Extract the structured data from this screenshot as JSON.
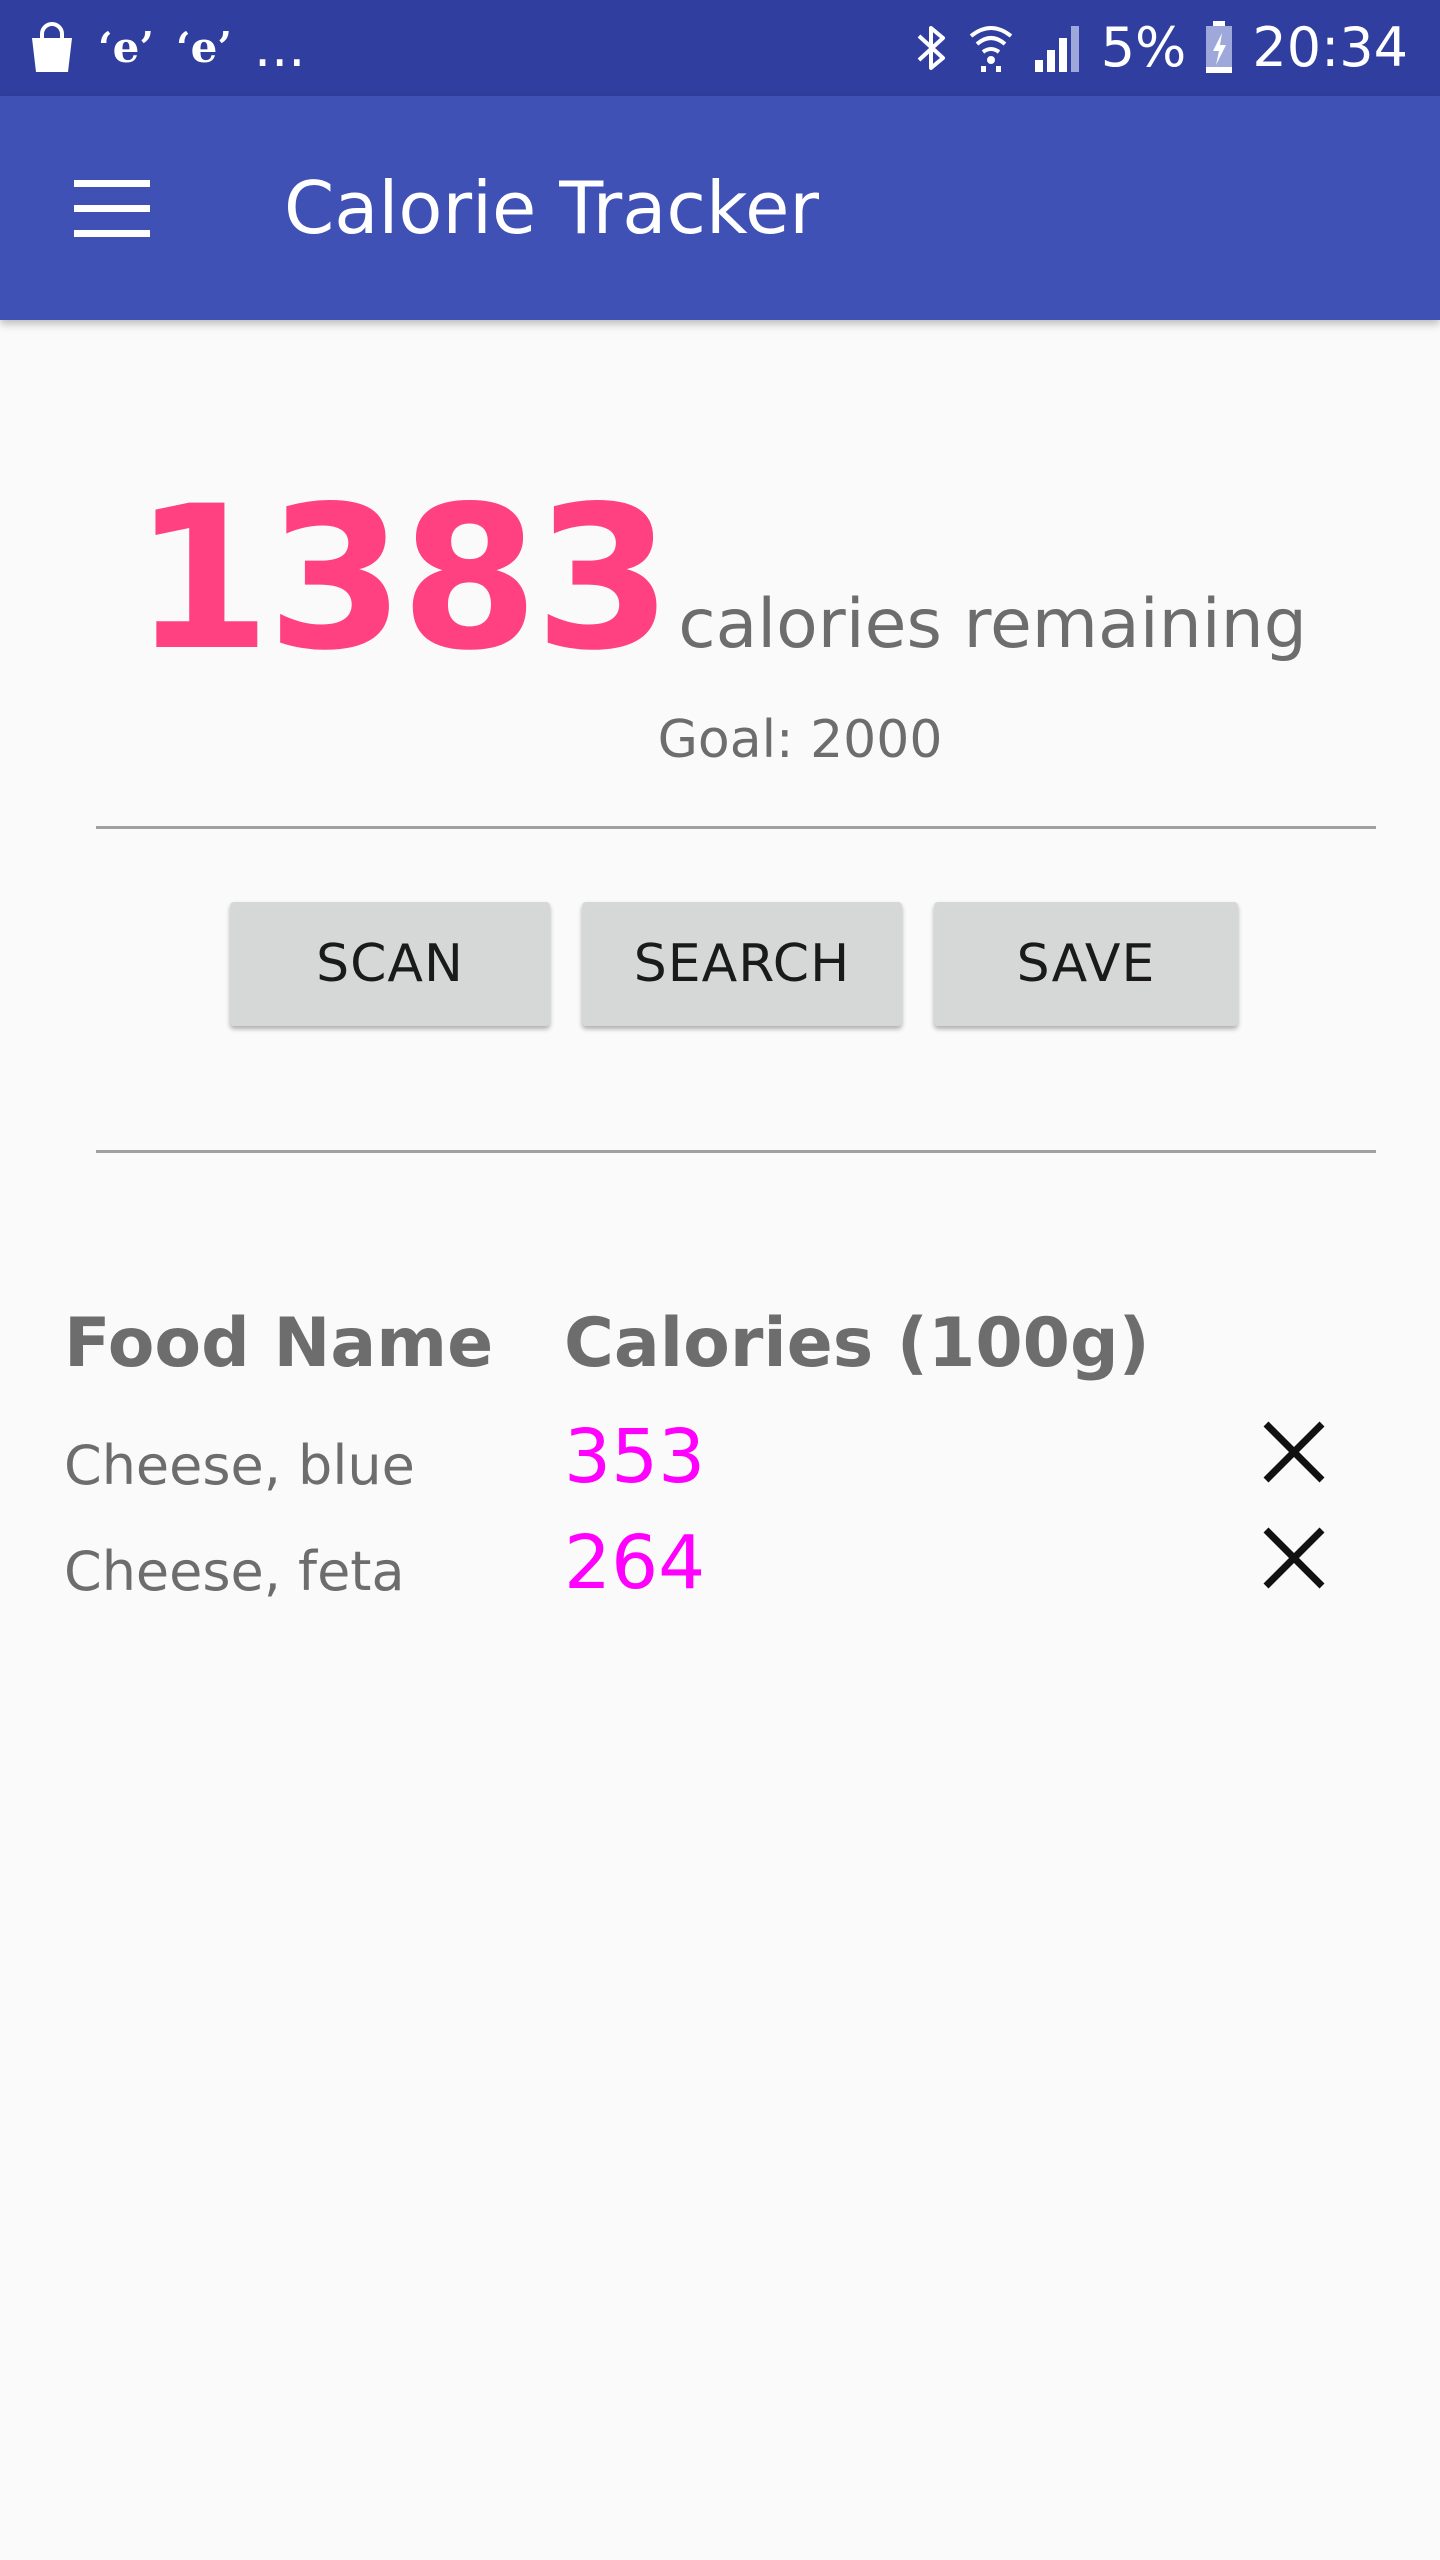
{
  "status_bar": {
    "overflow": "...",
    "battery": "5%",
    "time": "20:34",
    "icons": [
      "shopping-bag-icon",
      "e-app-icon",
      "e-app-icon",
      "bluetooth-icon",
      "wifi-icon",
      "signal-icon",
      "battery-charging-icon"
    ]
  },
  "app_bar": {
    "title": "Calorie Tracker",
    "menu_icon": "hamburger-menu-icon"
  },
  "summary": {
    "remaining": "1383",
    "remaining_label": "calories remaining",
    "goal": "Goal: 2000"
  },
  "buttons": {
    "scan": "SCAN",
    "search": "SEARCH",
    "save": "SAVE"
  },
  "table": {
    "headers": [
      "Food Name",
      "Calories (100g)"
    ],
    "rows": [
      {
        "name": "Cheese, blue",
        "calories": "353",
        "delete_icon": "close-icon"
      },
      {
        "name": "Cheese, feta",
        "calories": "264",
        "delete_icon": "close-icon"
      }
    ]
  },
  "colors": {
    "status_bar": "#303f9f",
    "app_bar": "#3f51b5",
    "accent_pink": "#ff4081",
    "calorie_magenta": "#ff00ff",
    "text_gray": "#6d6d6d",
    "button_gray": "#d6d7d7"
  }
}
